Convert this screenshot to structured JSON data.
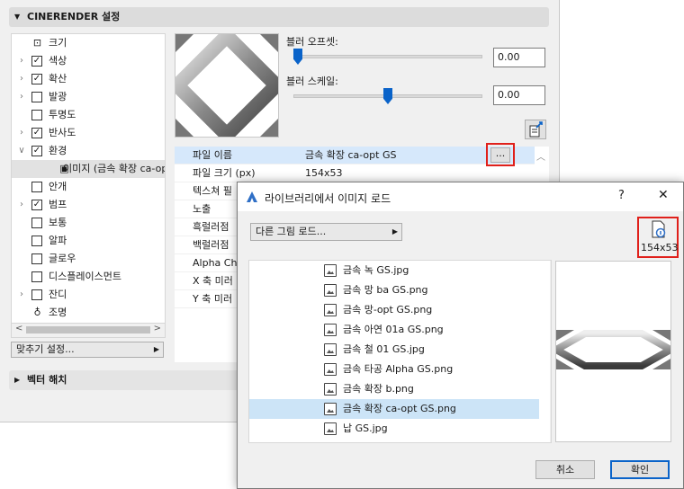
{
  "cinerender": {
    "header": "CINERENDER 설정",
    "tree": [
      {
        "label": "크기",
        "expander": "",
        "checkbox": "none",
        "icon": "size-icon"
      },
      {
        "label": "색상",
        "expander": ">",
        "checkbox": "checked"
      },
      {
        "label": "확산",
        "expander": ">",
        "checkbox": "checked"
      },
      {
        "label": "발광",
        "expander": ">",
        "checkbox": "unchecked"
      },
      {
        "label": "투명도",
        "expander": "",
        "checkbox": "unchecked"
      },
      {
        "label": "반사도",
        "expander": ">",
        "checkbox": "checked"
      },
      {
        "label": "환경",
        "expander": "v",
        "checkbox": "checked"
      },
      {
        "label": "이미지 (금속 확장 ca-op",
        "expander": "",
        "checkbox": "none",
        "icon": "image-icon",
        "selected": true
      },
      {
        "label": "안개",
        "expander": "",
        "checkbox": "unchecked"
      },
      {
        "label": "범프",
        "expander": ">",
        "checkbox": "checked"
      },
      {
        "label": "보통",
        "expander": "",
        "checkbox": "unchecked"
      },
      {
        "label": "알파",
        "expander": "",
        "checkbox": "unchecked"
      },
      {
        "label": "글로우",
        "expander": "",
        "checkbox": "unchecked"
      },
      {
        "label": "디스플레이스먼트",
        "expander": "",
        "checkbox": "unchecked"
      },
      {
        "label": "잔디",
        "expander": ">",
        "checkbox": "unchecked"
      },
      {
        "label": "조명",
        "expander": "",
        "checkbox": "none",
        "icon": "light-icon"
      }
    ],
    "fit_settings_label": "맞추기 설정...",
    "blur_offset": {
      "label": "블러 오프셋:",
      "value": "0.00",
      "level": 0.0
    },
    "blur_scale": {
      "label": "블러 스케일:",
      "value": "0.00",
      "level": 0.5
    },
    "properties": [
      {
        "name": "파일 이름",
        "value": "금속 확장 ca-opt GS",
        "selected": true
      },
      {
        "name": "파일 크기 (px)",
        "value": "154x53"
      },
      {
        "name": "텍스쳐 필",
        "value": ""
      },
      {
        "name": "노출",
        "value": ""
      },
      {
        "name": "흑럴러점",
        "value": ""
      },
      {
        "name": "백럴러점",
        "value": ""
      },
      {
        "name": "Alpha Cha",
        "value": ""
      },
      {
        "name": "X 축 미러",
        "value": ""
      },
      {
        "name": "Y 축 미러",
        "value": ""
      }
    ],
    "browse_button": "...",
    "vector_hatch_header": "벡터 해치"
  },
  "dialog": {
    "title": "라이브러리에서 이미지 로드",
    "help": "?",
    "close": "✕",
    "load_other": "다른 그림 로드...",
    "size_badge": "154x53",
    "files": [
      "금속 녹 GS.jpg",
      "금속 망 ba GS.png",
      "금속 망-opt GS.png",
      "금속 아연 01a GS.png",
      "금속 철 01 GS.jpg",
      "금속 타공 Alpha GS.png",
      "금속 확장 b.png",
      "금속 확장 ca-opt GS.png",
      "납 GS.jpg"
    ],
    "selected_file_index": 7,
    "cancel": "취소",
    "ok": "확인"
  },
  "colors": {
    "accent": "#0a63c9",
    "highlight": "#e0201b",
    "selection": "#cce4f7"
  }
}
